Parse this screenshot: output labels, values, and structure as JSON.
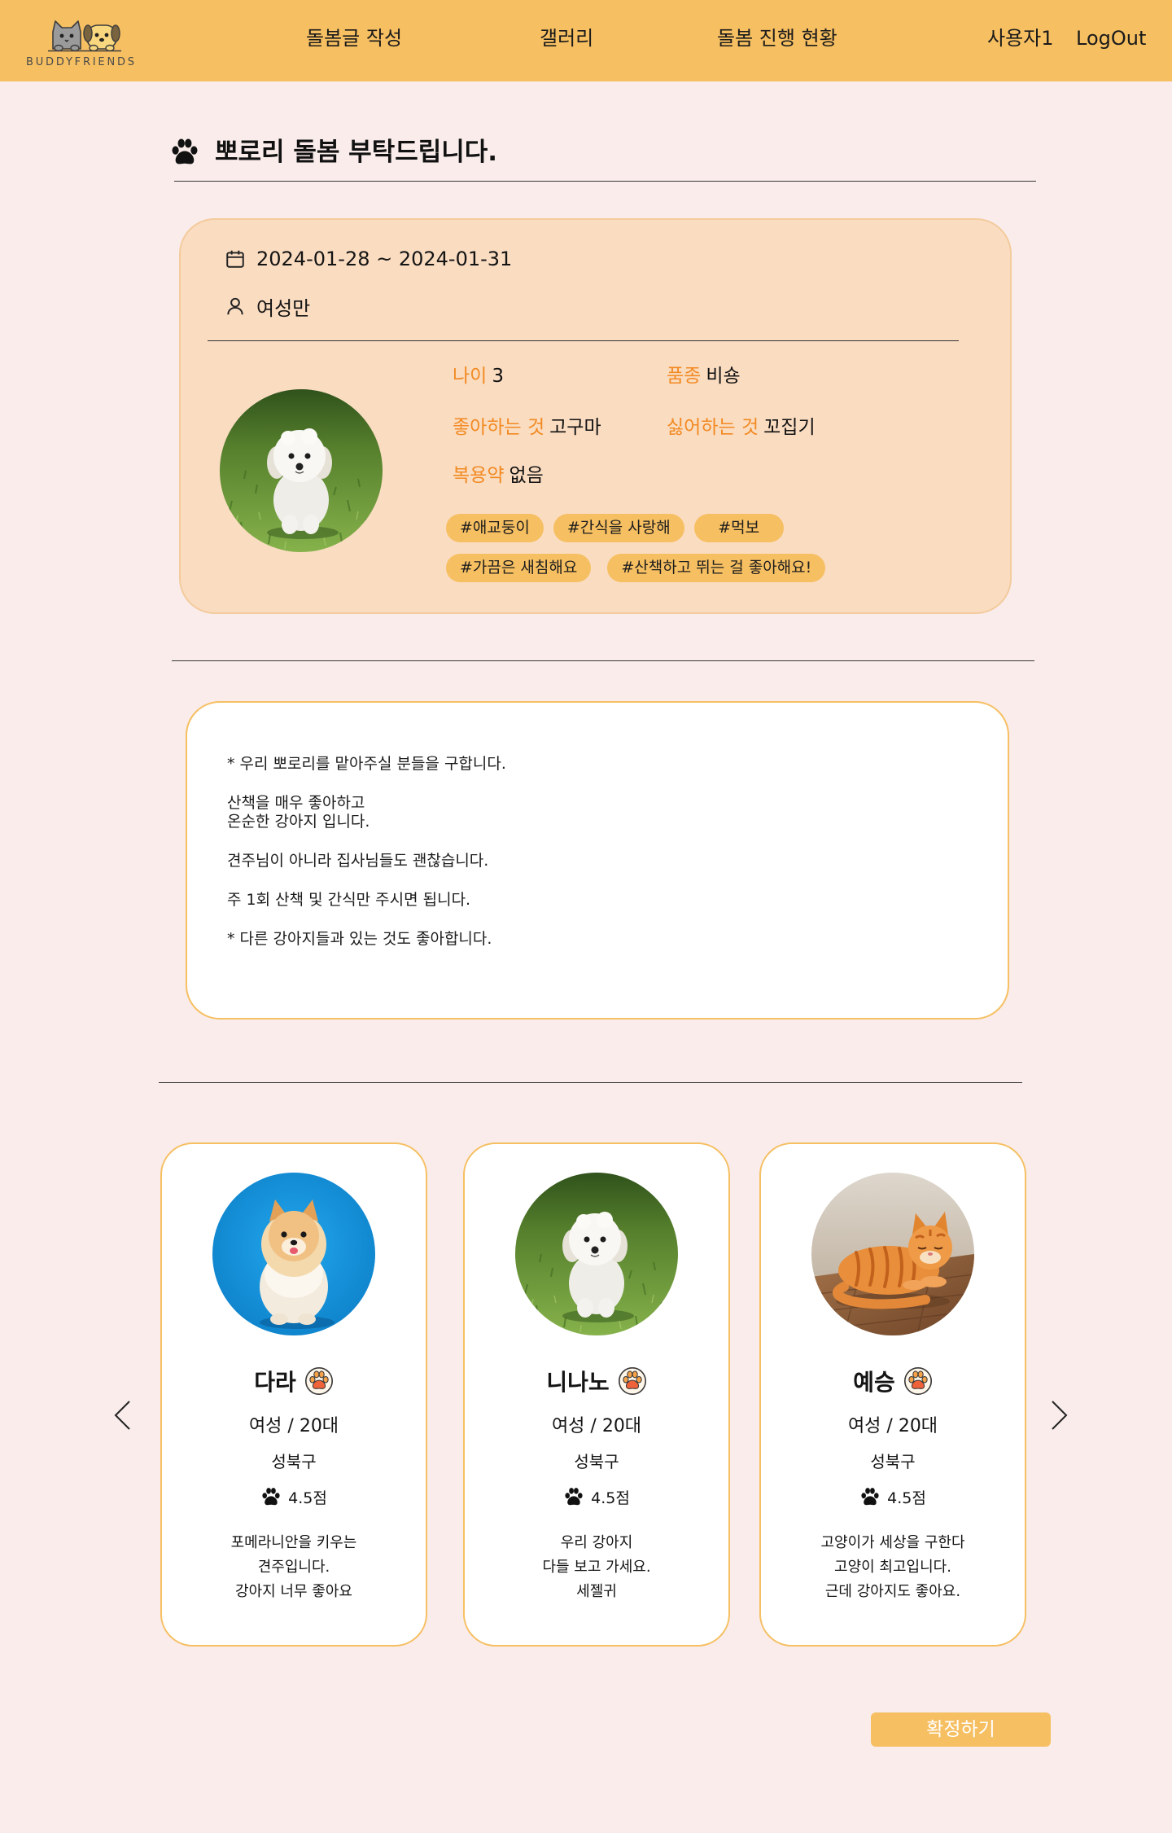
{
  "colors": {
    "primary": "#f6bf62",
    "accent_text": "#f28a22",
    "page_background": "#f9ecea",
    "info_card": "#fadcc1"
  },
  "header": {
    "logo_text": "BUDDYFRIENDS",
    "nav": [
      {
        "label": "돌봄글 작성"
      },
      {
        "label": "갤러리"
      },
      {
        "label": "돌봄 진행 현황"
      }
    ],
    "user_name": "사용자1",
    "logout_label": "LogOut"
  },
  "post": {
    "title_icon": "paw-icon",
    "title": "뽀로리 돌봄 부탁드립니다.",
    "date_range": "2024-01-28 ~ 2024-01-31",
    "gender_preference": "여성만",
    "pet": {
      "age_label": "나이",
      "age": "3",
      "breed_label": "품종",
      "breed": "비숑",
      "likes_label": "좋아하는 것",
      "likes": "고구마",
      "dislikes_label": "싫어하는 것",
      "dislikes": "꼬집기",
      "medicine_label": "복용약",
      "medicine": "없음",
      "tags": [
        "#애교둥이",
        "#간식을 사랑해",
        "#먹보",
        "#가끔은 새침해요",
        "#산책하고 뛰는 걸 좋아해요!"
      ]
    },
    "description": [
      [
        "* 우리 뽀로리를 맡아주실 분들을 구합니다."
      ],
      [
        "산책을 매우 좋아하고",
        "온순한 강아지 입니다."
      ],
      [
        "견주님이 아니라 집사님들도 괜찮습니다."
      ],
      [
        "주 1회 산책 및 간식만 주시면 됩니다."
      ],
      [
        "* 다른 강아지들과 있는 것도 좋아합니다."
      ]
    ]
  },
  "sitters": [
    {
      "name": "다라",
      "gender_age": "여성 / 20대",
      "region": "성북구",
      "rating": "4.5점",
      "bio": [
        "포메라니안을 키우는",
        "견주입니다.",
        "강아지 너무 좋아요"
      ]
    },
    {
      "name": "니나노",
      "gender_age": "여성 / 20대",
      "region": "성북구",
      "rating": "4.5점",
      "bio": [
        "우리 강아지",
        "다들 보고 가세요.",
        "세젤귀"
      ]
    },
    {
      "name": "예승",
      "gender_age": "여성 / 20대",
      "region": "성북구",
      "rating": "4.5점",
      "bio": [
        "고양이가 세상을 구한다",
        "고양이 최고입니다.",
        "근데 강아지도 좋아요."
      ]
    }
  ],
  "carousel": {
    "prev_icon": "chevron-left-icon",
    "next_icon": "chevron-right-icon"
  },
  "confirm_label": "확정하기"
}
